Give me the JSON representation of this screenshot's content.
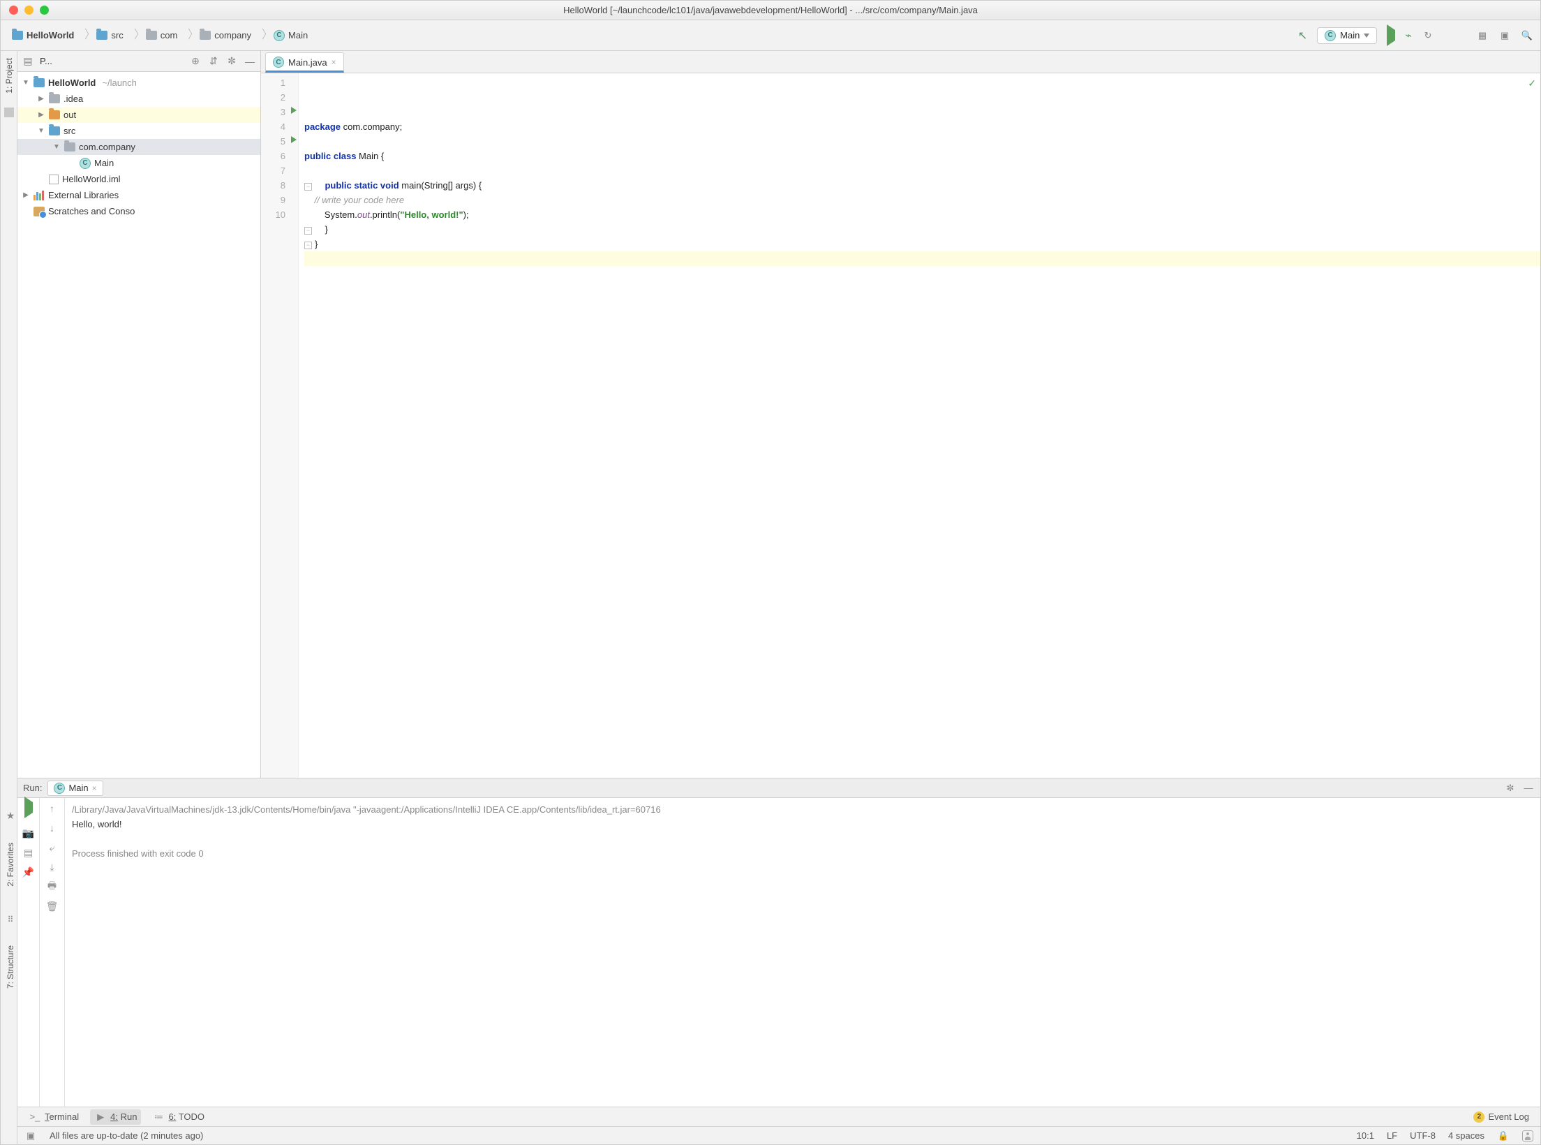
{
  "title": "HelloWorld [~/launchcode/lc101/java/javawebdevelopment/HelloWorld] - .../src/com/company/Main.java",
  "breadcrumb": [
    {
      "label": "HelloWorld",
      "bold": true,
      "icon": "project"
    },
    {
      "label": "src",
      "icon": "folder-blue"
    },
    {
      "label": "com",
      "icon": "folder"
    },
    {
      "label": "company",
      "icon": "folder"
    },
    {
      "label": "Main",
      "icon": "class"
    }
  ],
  "run_config": {
    "label": "Main"
  },
  "project_header": {
    "label": "P..."
  },
  "project_tree": [
    {
      "indent": 0,
      "arrow": "down",
      "icon": "project",
      "text": "HelloWorld",
      "bold": true,
      "suffix": "~/launch",
      "sel": false
    },
    {
      "indent": 1,
      "arrow": "right",
      "icon": "folder",
      "text": ".idea"
    },
    {
      "indent": 1,
      "arrow": "right",
      "icon": "folder-orange",
      "text": "out",
      "hl": true
    },
    {
      "indent": 1,
      "arrow": "down",
      "icon": "folder-blue",
      "text": "src"
    },
    {
      "indent": 2,
      "arrow": "down",
      "icon": "folder",
      "text": "com.company",
      "sel": true
    },
    {
      "indent": 3,
      "arrow": "",
      "icon": "class",
      "text": "Main"
    },
    {
      "indent": 1,
      "arrow": "",
      "icon": "iml",
      "text": "HelloWorld.iml"
    },
    {
      "indent": 0,
      "arrow": "right",
      "icon": "lib",
      "text": "External Libraries"
    },
    {
      "indent": 0,
      "arrow": "",
      "icon": "scratch",
      "text": "Scratches and Conso"
    }
  ],
  "editor": {
    "tab_label": "Main.java",
    "lines": [
      {
        "n": 1,
        "spans": [
          {
            "c": "kw",
            "t": "package"
          },
          {
            "c": "pln",
            "t": " com.company;"
          }
        ]
      },
      {
        "n": 2,
        "spans": []
      },
      {
        "n": 3,
        "run": true,
        "spans": [
          {
            "c": "kw",
            "t": "public class"
          },
          {
            "c": "pln",
            "t": " Main {"
          }
        ]
      },
      {
        "n": 4,
        "spans": []
      },
      {
        "n": 5,
        "run": true,
        "fold": true,
        "spans": [
          {
            "c": "pln",
            "t": "    "
          },
          {
            "c": "kw",
            "t": "public static void"
          },
          {
            "c": "pln",
            "t": " main(String[] args) {"
          }
        ]
      },
      {
        "n": 6,
        "spans": [
          {
            "c": "pln",
            "t": "    "
          },
          {
            "c": "cm",
            "t": "// write your code here"
          }
        ]
      },
      {
        "n": 7,
        "spans": [
          {
            "c": "pln",
            "t": "        System."
          },
          {
            "c": "fld",
            "t": "out"
          },
          {
            "c": "pln",
            "t": ".println("
          },
          {
            "c": "str",
            "t": "\"Hello, world!\""
          },
          {
            "c": "pln",
            "t": ");"
          }
        ]
      },
      {
        "n": 8,
        "fold": true,
        "spans": [
          {
            "c": "pln",
            "t": "    }"
          }
        ]
      },
      {
        "n": 9,
        "fold": true,
        "spans": [
          {
            "c": "pln",
            "t": "}"
          }
        ]
      },
      {
        "n": 10,
        "hl": true,
        "spans": []
      }
    ]
  },
  "run_panel": {
    "title": "Run:",
    "tab": "Main",
    "lines": [
      {
        "dim": true,
        "t": "/Library/Java/JavaVirtualMachines/jdk-13.jdk/Contents/Home/bin/java \"-javaagent:/Applications/IntelliJ IDEA CE.app/Contents/lib/idea_rt.jar=60716"
      },
      {
        "dim": false,
        "t": "Hello, world!"
      },
      {
        "dim": false,
        "t": ""
      },
      {
        "dim": true,
        "t": "Process finished with exit code 0"
      }
    ]
  },
  "left_tools": [
    {
      "label": "1: Project"
    }
  ],
  "left_tools_bottom": [
    {
      "label": "2: Favorites"
    },
    {
      "label": "7: Structure"
    }
  ],
  "bottom_tabs": [
    {
      "icon": "terminal",
      "label": "Terminal"
    },
    {
      "icon": "play",
      "label": "4: Run",
      "active": true
    },
    {
      "icon": "list",
      "label": "6: TODO"
    }
  ],
  "event_log": {
    "count": "2",
    "label": "Event Log"
  },
  "status": {
    "msg": "All files are up-to-date (2 minutes ago)",
    "pos": "10:1",
    "lf": "LF",
    "enc": "UTF-8",
    "indent": "4 spaces"
  }
}
